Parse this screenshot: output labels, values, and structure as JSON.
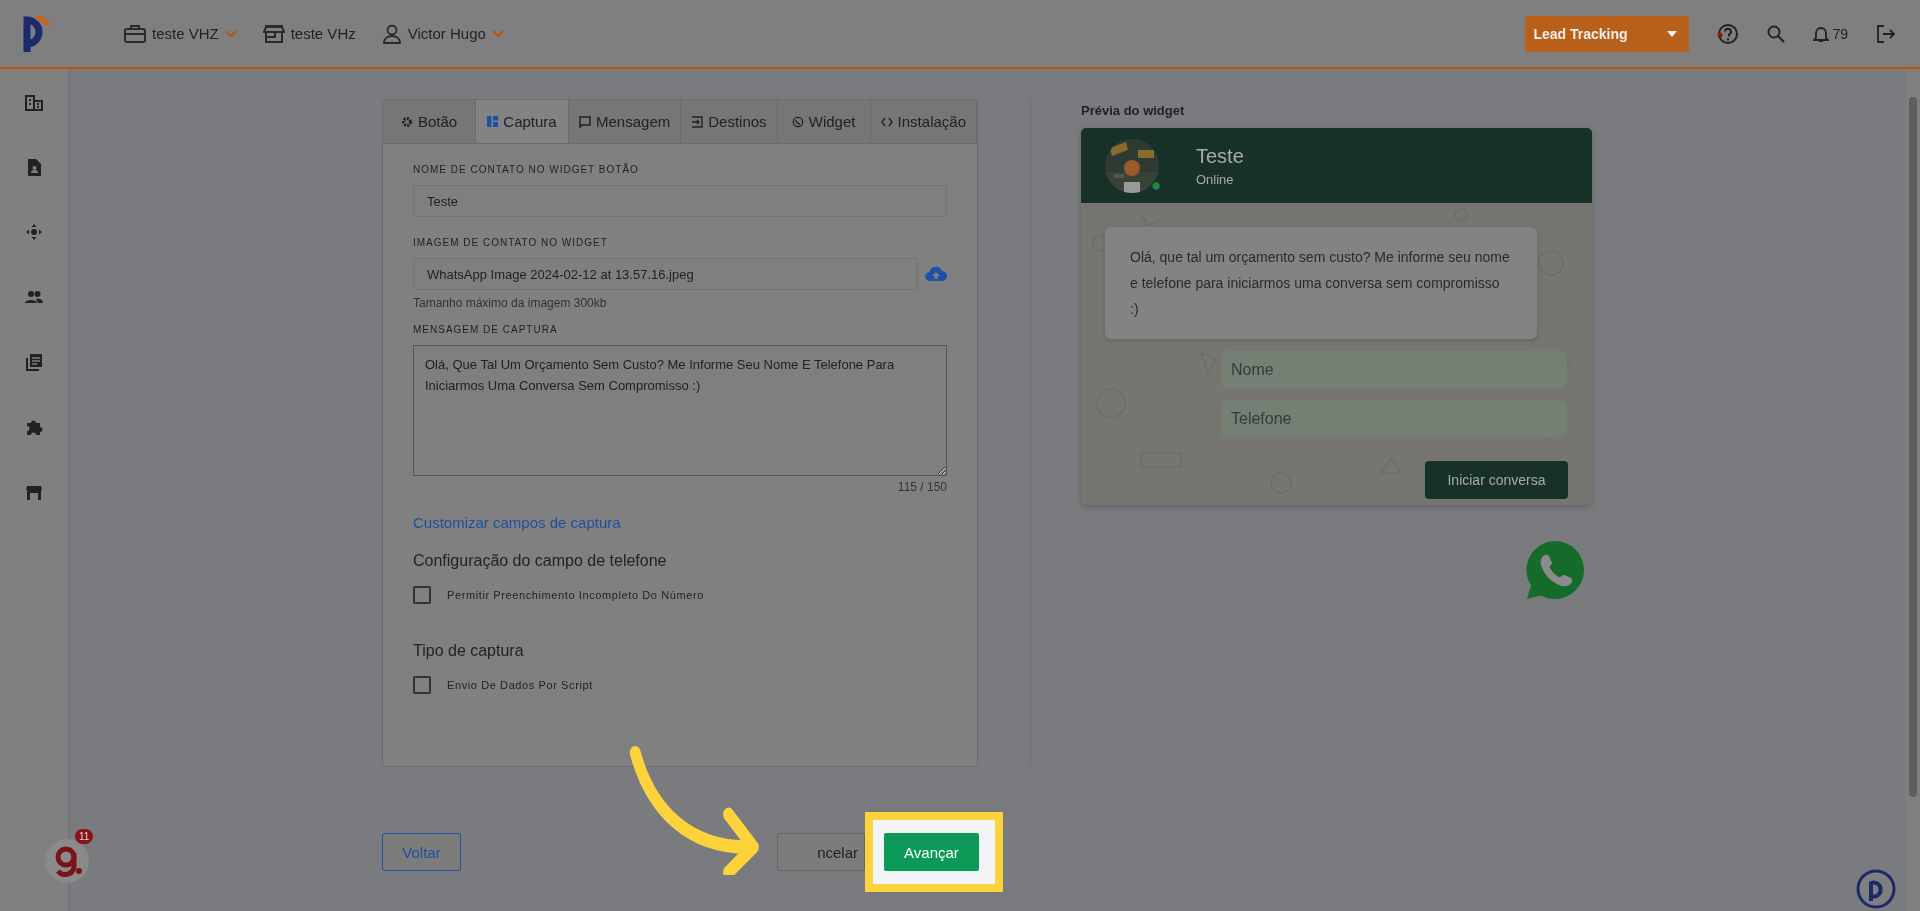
{
  "topbar": {
    "selectors": [
      {
        "kind": "company",
        "label": "teste VHZ",
        "dropdown": true
      },
      {
        "kind": "store",
        "label": "teste VHz",
        "dropdown": false
      },
      {
        "kind": "user",
        "label": "Victor Hugo",
        "dropdown": true
      }
    ],
    "lead_button": "Lead Tracking",
    "notifications": "79"
  },
  "tabs": [
    {
      "label": "Botão",
      "selected": false
    },
    {
      "label": "Captura",
      "selected": true
    },
    {
      "label": "Mensagem",
      "selected": false
    },
    {
      "label": "Destinos",
      "selected": false
    },
    {
      "label": "Widget",
      "selected": false
    },
    {
      "label": "Instalação",
      "selected": false
    }
  ],
  "form": {
    "contact_name": {
      "label": "NOME DE CONTATO NO WIDGET BOTÃO",
      "value": "Teste"
    },
    "contact_image": {
      "label": "IMAGEM DE CONTATO NO WIDGET",
      "value": "WhatsApp Image 2024-02-12 at 13.57.16.jpeg",
      "hint": "Tamanho máximo da imagem 300kb"
    },
    "capture_message": {
      "label": "MENSAGEM DE CAPTURA",
      "value": "Olá, Que Tal Um Orçamento Sem Custo? Me Informe Seu Nome E Telefone Para Iniciarmos Uma Conversa Sem Compromisso :)",
      "counter": "115 / 150"
    },
    "customize_link": "Customizar campos de captura",
    "sections": [
      {
        "title": "Configuração do campo de telefone",
        "options": [
          {
            "label": "Permitir Preenchimento Incompleto Do Número",
            "checked": false
          }
        ]
      },
      {
        "title": "Tipo de captura",
        "options": [
          {
            "label": "Envio De Dados Por Script",
            "checked": false
          }
        ]
      }
    ]
  },
  "preview": {
    "title": "Prévia do widget",
    "contact_name": "Teste",
    "status": "Online",
    "message": "Olá, que tal um orçamento sem custo? Me informe seu nome e telefone para iniciarmos uma conversa sem compromisso :)",
    "fields": [
      {
        "placeholder": "Nome"
      },
      {
        "placeholder": "Telefone"
      }
    ],
    "start_button": "Iniciar conversa"
  },
  "footer": {
    "back": "Voltar",
    "cancel": "ncelar",
    "next": "Avançar"
  },
  "help_badge": "11"
}
